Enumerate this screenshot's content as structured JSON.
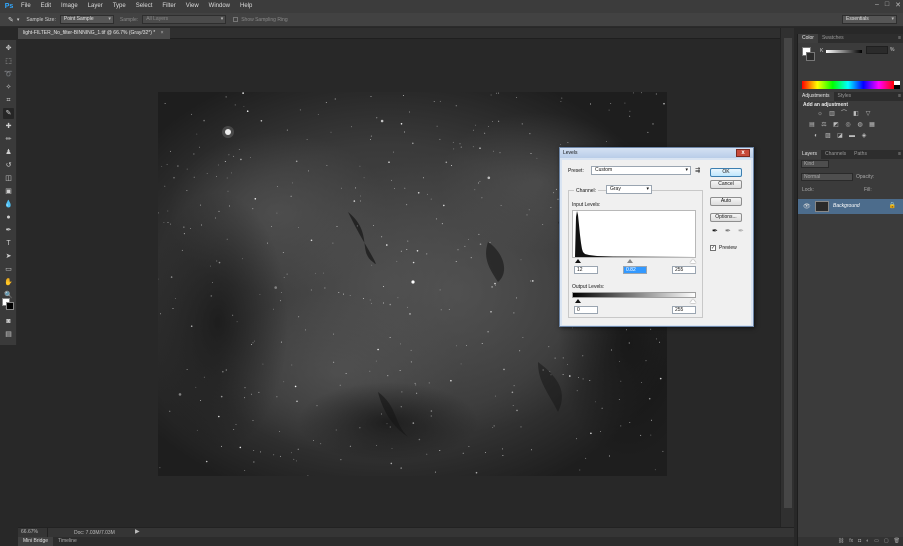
{
  "menubar": {
    "logo": "Ps",
    "items": [
      "File",
      "Edit",
      "Image",
      "Layer",
      "Type",
      "Select",
      "Filter",
      "View",
      "Window",
      "Help"
    ]
  },
  "options": {
    "sample_size_label": "Sample Size:",
    "sample_size_value": "Point Sample",
    "sample_label": "Sample:",
    "sample_value": "All Layers",
    "sampling_ring_label": "Show Sampling Ring",
    "workspace": "Essentials"
  },
  "document": {
    "tab_title": "light-FILTER_No_filter-BINNING_1.tif @ 66.7% (Gray/32*) *",
    "close_glyph": "×"
  },
  "status": {
    "zoom": "66.67%",
    "doc_info": "Doc: 7.03M/7.03M",
    "arrow": "▶"
  },
  "bottom_tabs": [
    "Mini Bridge",
    "Timeline"
  ],
  "panels": {
    "color_tabs": [
      "Color",
      "Swatches"
    ],
    "k_label": "K",
    "k_percent": "%",
    "adjustments_tabs": [
      "Adjustments",
      "Styles"
    ],
    "adjustments_title": "Add an adjustment",
    "layers_tabs": [
      "Layers",
      "Channels",
      "Paths"
    ],
    "kind_filter": "Kind",
    "blend_mode": "Normal",
    "opacity_label": "Opacity:",
    "lock_label": "Lock:",
    "fill_label": "Fill:",
    "layer_name": "Background"
  },
  "levels": {
    "title": "Levels",
    "close": "x",
    "preset_label": "Preset:",
    "preset_value": "Custom",
    "channel_label": "Channel:",
    "channel_value": "Gray",
    "input_levels_label": "Input Levels:",
    "input_black": "12",
    "input_gray": "0.82",
    "input_white": "255",
    "output_levels_label": "Output Levels:",
    "output_black": "0",
    "output_white": "255",
    "buttons": {
      "ok": "OK",
      "cancel": "Cancel",
      "auto": "Auto",
      "options": "Options..."
    },
    "preview_label": "Preview",
    "preview_checked": true
  },
  "colors": {
    "app_bg": "#282828",
    "layer_selected": "#4c6c8c",
    "dialog_bg": "#f0f0f0",
    "accent": "#31a8ff"
  }
}
